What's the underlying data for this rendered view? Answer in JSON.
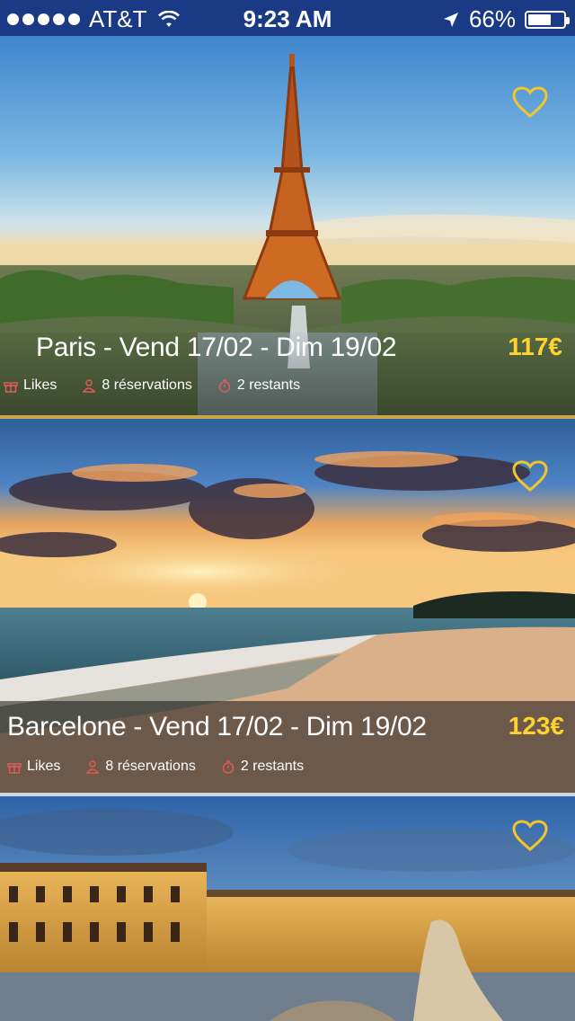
{
  "status_bar": {
    "carrier": "AT&T",
    "time": "9:23 AM",
    "battery": "66%",
    "battery_level": 0.66
  },
  "colors": {
    "status_bar_bg": "#1a3a86",
    "price": "#ffd22e",
    "heart": "#f3c52c",
    "divider": "#c9a648"
  },
  "cards": [
    {
      "title": "Paris - Vend 17/02 - Dim 19/02",
      "price": "117€",
      "likes_label": "Likes",
      "reservations_label": "8 réservations",
      "remaining_label": "2 restants",
      "favorite_icon": "heart-outline-icon"
    },
    {
      "title": "Barcelone - Vend 17/02 - Dim 19/02",
      "price": "123€",
      "likes_label": "Likes",
      "reservations_label": "8 réservations",
      "remaining_label": "2 restants",
      "favorite_icon": "heart-outline-icon"
    },
    {
      "favorite_icon": "heart-outline-icon"
    }
  ]
}
